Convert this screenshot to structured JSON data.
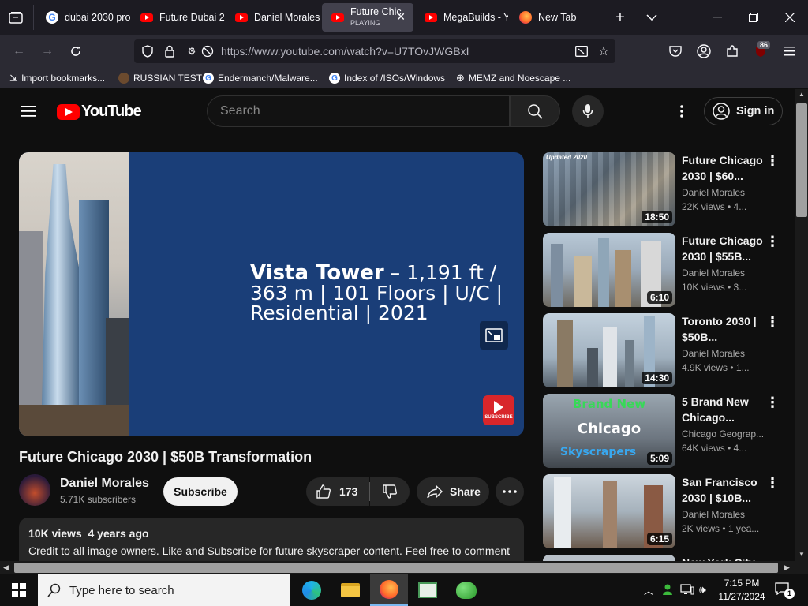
{
  "browser": {
    "tabs": [
      {
        "title": "dubai 2030 pro",
        "icon": "google-icon"
      },
      {
        "title": "Future Dubai 2",
        "icon": "youtube-icon"
      },
      {
        "title": "Daniel Morales",
        "icon": "youtube-icon"
      },
      {
        "title": "Future Chica",
        "subtitle": "PLAYING",
        "icon": "youtube-icon",
        "active": true
      },
      {
        "title": "MegaBuilds - Y",
        "icon": "youtube-icon"
      },
      {
        "title": "New Tab",
        "icon": "firefox-icon"
      }
    ],
    "url": "https://www.youtube.com/watch?v=U7TOvJWGBxI",
    "extension_badge": "86",
    "bookmarks": [
      {
        "label": "Import bookmarks...",
        "icon": "import-icon"
      },
      {
        "label": "RUSSIAN TEST",
        "icon": "page-icon"
      },
      {
        "label": "Endermanch/Malware...",
        "icon": "google-icon"
      },
      {
        "label": "Index of /ISOs/Windows",
        "icon": "google-icon"
      },
      {
        "label": "MEMZ and Noescape ...",
        "icon": "globe-icon"
      }
    ]
  },
  "youtube": {
    "logo_text": "YouTube",
    "search_placeholder": "Search",
    "sign_in": "Sign in",
    "video": {
      "overlay_line_bold": "Vista Tower",
      "overlay_line_rest": " – 1,191 ft / 363 m | 101 Floors | U/C | Residential | 2021",
      "subscribe_watermark": "SUBSCRIBE",
      "title": "Future Chicago 2030 | $50B Transformation",
      "channel": "Daniel Morales",
      "subscribers": "5.71K subscribers",
      "subscribe_label": "Subscribe",
      "likes": "173",
      "share_label": "Share",
      "views": "10K views",
      "age": "4 years ago",
      "description": "Credit to all image owners. Like and Subscribe for future skyscraper content. Feel free to comment"
    },
    "related": [
      {
        "title": "Future Chicago 2030 | $60...",
        "channel": "Daniel Morales",
        "meta": "22K views  • 4...",
        "duration": "18:50",
        "thumb_text": "Updated 2020"
      },
      {
        "title": "Future Chicago 2030 | $55B...",
        "channel": "Daniel Morales",
        "meta": "10K views  • 3...",
        "duration": "6:10"
      },
      {
        "title": "Toronto 2030 | $50B...",
        "channel": "Daniel Morales",
        "meta": "4.9K views  • 1...",
        "duration": "14:30"
      },
      {
        "title": "5 Brand New Chicago...",
        "channel": "Chicago Geograp...",
        "meta": "64K views  • 4...",
        "duration": "5:09",
        "thumb_lines": [
          "Brand New",
          "Chicago",
          "Skyscrapers"
        ]
      },
      {
        "title": "San Francisco 2030 | $10B...",
        "channel": "Daniel Morales",
        "meta": "2K views  • 1 yea...",
        "duration": "6:15"
      },
      {
        "title": "New York City..."
      }
    ]
  },
  "taskbar": {
    "search_placeholder": "Type here to search",
    "time": "7:15 PM",
    "date": "11/27/2024",
    "notification_count": "1"
  }
}
